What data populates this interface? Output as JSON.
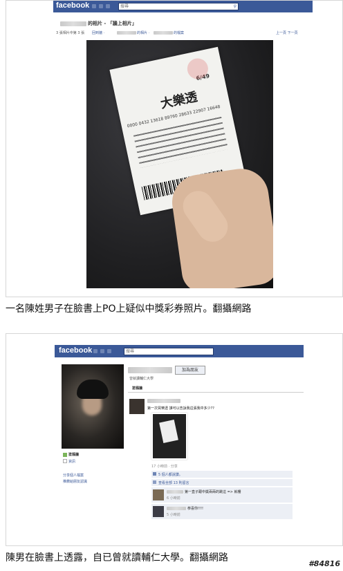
{
  "screenshot1": {
    "logo": "facebook",
    "search_placeholder": "搜尋",
    "album_title_suffix": "的相片 - 「牆上相片」",
    "photo_count": "3 張相片中第 3 張",
    "back_link": "回到牆 · ",
    "album_link_suffix": "的相片 · ",
    "profile_link_suffix": "的檔案",
    "prev_next": "上一頁  下一頁",
    "ticket": {
      "brand": "大樂透",
      "game": "6/49",
      "numbers": "0000 0432 13618 89760 28633 22907 16648"
    }
  },
  "caption1": "一名陳姓男子在臉書上PO上疑似中獎彩券照片。翻攝網路",
  "screenshot2": {
    "logo": "facebook",
    "search_placeholder": "搜尋",
    "add_friend": "加為朋友",
    "sub_heading": "曾就讀輔仁大學",
    "wall_tab": "塗鴉牆",
    "sidebar_wall": "塗鴉牆",
    "sidebar_info": "資訊",
    "share_profile": "分享個人檔案",
    "suggest_friends": "推薦給朋友認識",
    "post_text": "第一次買樂透 誰可以告訴我這張我中多少??",
    "post_time": "17 小時前 · 分享",
    "likes": "5 個人都說讚。",
    "view_all_comments": "查看全部 13 則留言",
    "comment1": "第一直子跟中獎兩兩的跳這 => 就樓",
    "comment1_time": "6 小時前",
    "comment2": "恭喜你!!!!",
    "comment2_time": "5 小時前"
  },
  "caption2": "陳男在臉書上透露，自已曾就讀輔仁大學。翻攝網路",
  "watermark": "#84816"
}
